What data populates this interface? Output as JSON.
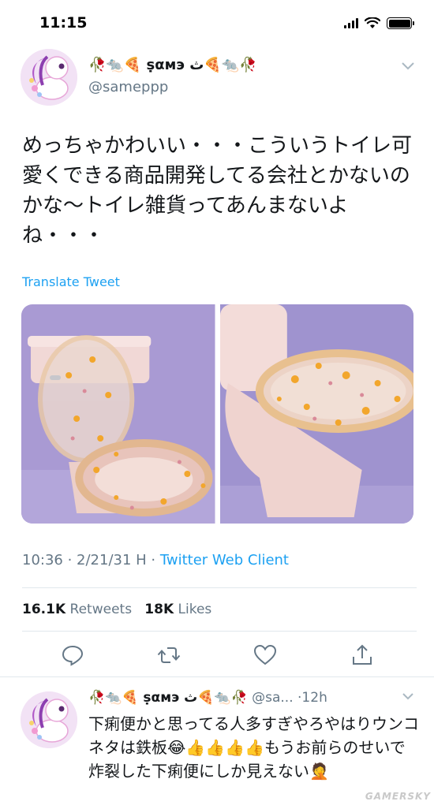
{
  "status_bar": {
    "time": "11:15"
  },
  "tweet": {
    "display_name": "🥀🐀🍕 ṣαмэ ث🍕🐀🥀",
    "handle": "@sameppp",
    "text": "めっちゃかわいい・・・こういうトイレ可愛くできる商品開発してる会社とかないのかな〜トイレ雑貨ってあんまないよね・・・",
    "translate_label": "Translate Tweet",
    "timestamp": "10:36 · 2/21/31 H · ",
    "client": "Twitter Web Client",
    "retweets_count": "16.1K",
    "retweets_label": "Retweets",
    "likes_count": "18K",
    "likes_label": "Likes"
  },
  "reply": {
    "display_name": "🥀🐀🍕 ṣαмэ ث🍕🐀🥀",
    "handle": "@sa...",
    "time": "·12h",
    "text": "下痢便かと思ってる人多すぎやろやはりウンコネタは鉄板😂👍👍👍👍もうお前らのせいで炸裂した下痢便にしか見えない🤦"
  },
  "icons": {
    "reply": "reply-icon",
    "retweet": "retweet-icon",
    "like": "heart-icon",
    "share": "share-icon",
    "more": "chevron-down-icon"
  },
  "colors": {
    "accent": "#1da1f2",
    "secondary_text": "#657786",
    "primary_text": "#14171a",
    "divider": "#e1e8ed"
  },
  "watermark": "GAMERSKY"
}
